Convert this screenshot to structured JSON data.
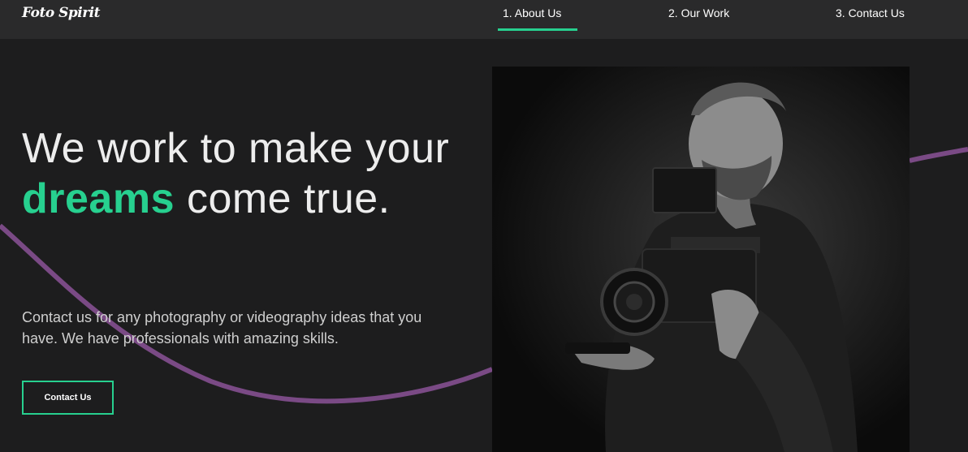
{
  "brand": {
    "logo_text": "Foto Spirit"
  },
  "nav": {
    "items": [
      {
        "label": "1. About Us",
        "active": true
      },
      {
        "label": "2. Our Work",
        "active": false
      },
      {
        "label": "3. Contact Us",
        "active": false
      }
    ]
  },
  "hero": {
    "title_before": "We work to make your ",
    "title_accent": "dreams",
    "title_after": " come true.",
    "subtitle": "Contact us for any photography or videography ideas that you have. We have professionals with amazing skills.",
    "cta_label": "Contact Us"
  },
  "colors": {
    "accent": "#27d08f",
    "wave": "#7a4a85",
    "background": "#1d1d1e",
    "navbar": "#2a2a2b"
  },
  "image": {
    "subject": "photographer-with-camera-rig"
  }
}
